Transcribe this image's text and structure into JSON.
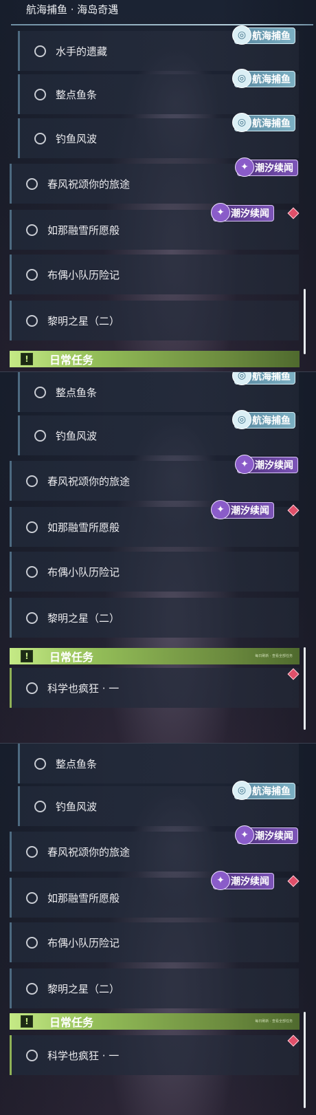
{
  "section_title": "航海捕鱼 · 海岛奇遇",
  "tags": {
    "fishing": "航海捕鱼",
    "tide": "潮汐续闻",
    "fishing_icon": "spiral-icon",
    "tide_icon": "sparkle-icon"
  },
  "quests": {
    "sailor": "水手的遗藏",
    "fish_bar": "整点鱼条",
    "fishing_storm": "钓鱼风波",
    "spring_breeze": "春风祝颂你的旅途",
    "melting_snow": "如那融雪所愿般",
    "doll_squad": "布偶小队历险记",
    "dawn_star": "黎明之星（二）",
    "science": "科学也疯狂 · 一"
  },
  "daily": {
    "title": "日常任务",
    "icon": "!",
    "note": "每日刷新 · 查看全部任务"
  },
  "colors": {
    "fishing_tag": "#6a9eb4",
    "tide_tag": "#6b45a3",
    "daily_accent": "#9cc65e",
    "alert_diamond": "#e0506a"
  }
}
